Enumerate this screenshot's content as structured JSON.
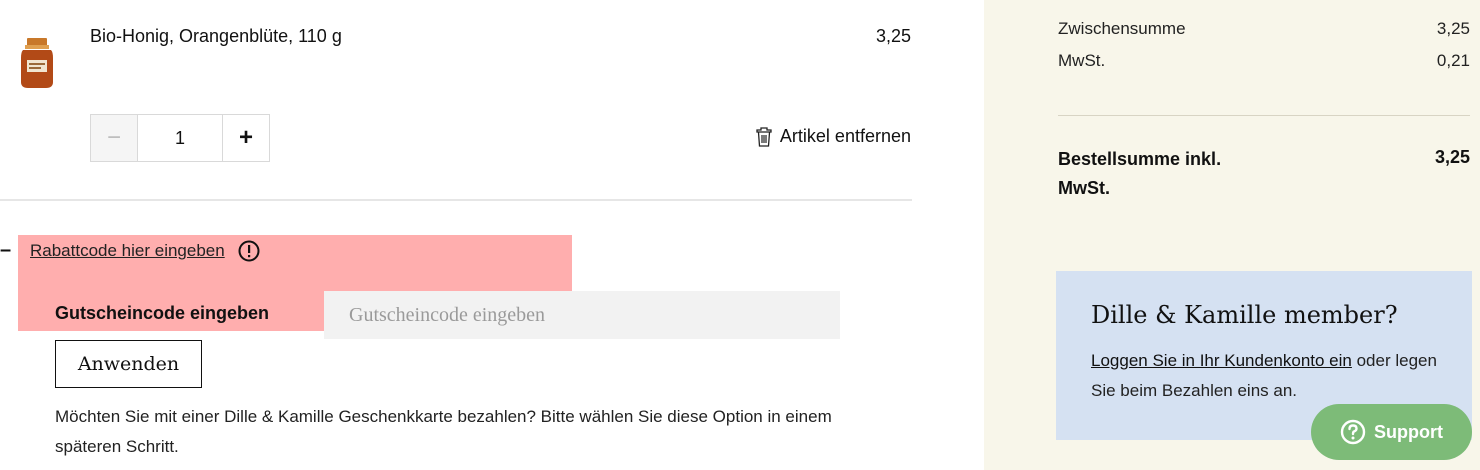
{
  "cart": {
    "item": {
      "name": "Bio-Honig, Orangenblüte, 110 g",
      "price": "3,25",
      "quantity": "1",
      "thumbnail_icon": "honey-jar-icon"
    },
    "stepper": {
      "minus_label": "−",
      "plus_label": "+"
    },
    "remove_label": "Artikel entfernen"
  },
  "discount": {
    "toggle_symbol": "–",
    "link_text": "Rabattcode hier eingeben",
    "coupon_label": "Gutscheincode eingeben",
    "coupon_placeholder": "Gutscheincode eingeben",
    "apply_label": "Anwenden",
    "giftcard_note": "Möchten Sie mit einer Dille & Kamille Geschenkkarte bezahlen? Bitte wählen Sie diese Option in einem späteren Schritt."
  },
  "summary": {
    "subtotal_label": "Zwischensumme",
    "subtotal_value": "3,25",
    "tax_label": "MwSt.",
    "tax_value": "0,21",
    "total_label": "Bestellsumme inkl. MwSt.",
    "total_value": "3,25"
  },
  "member": {
    "title": "Dille & Kamille member?",
    "login_link": "Loggen Sie in Ihr Kundenkonto ein",
    "text_rest": " oder legen Sie beim Bezahlen eins an."
  },
  "support": {
    "label": "Support"
  },
  "colors": {
    "summary_bg": "#f8f6ea",
    "member_bg": "#d5e1f2",
    "support_bg": "#7dbb78",
    "highlight": "#ff7878"
  }
}
